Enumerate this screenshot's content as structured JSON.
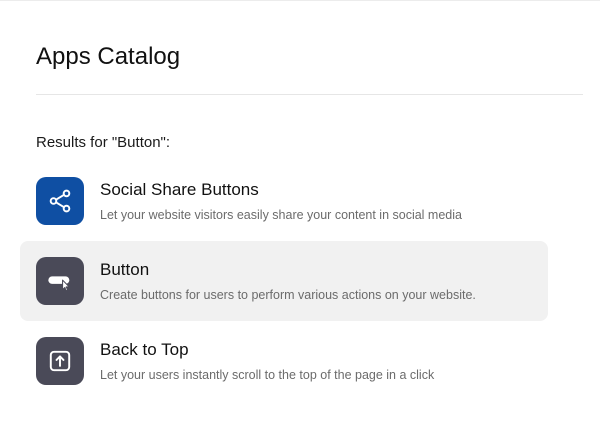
{
  "catalog": {
    "title": "Apps Catalog",
    "results_label": "Results for \"Button\":"
  },
  "colors": {
    "social_share_icon_bg": "#0f4fa3",
    "dark_icon_bg": "#4a4a58",
    "hover_row_bg": "#f1f1f1"
  },
  "apps": [
    {
      "name": "Social Share Buttons",
      "description": "Let your website visitors easily share your content in social media",
      "icon": "share-icon"
    },
    {
      "name": "Button",
      "description": "Create buttons for users to perform various actions on your website.",
      "icon": "button-cursor-icon"
    },
    {
      "name": "Back to Top",
      "description": "Let your users instantly scroll to the top of the page in a click",
      "icon": "arrow-up-box-icon"
    }
  ]
}
